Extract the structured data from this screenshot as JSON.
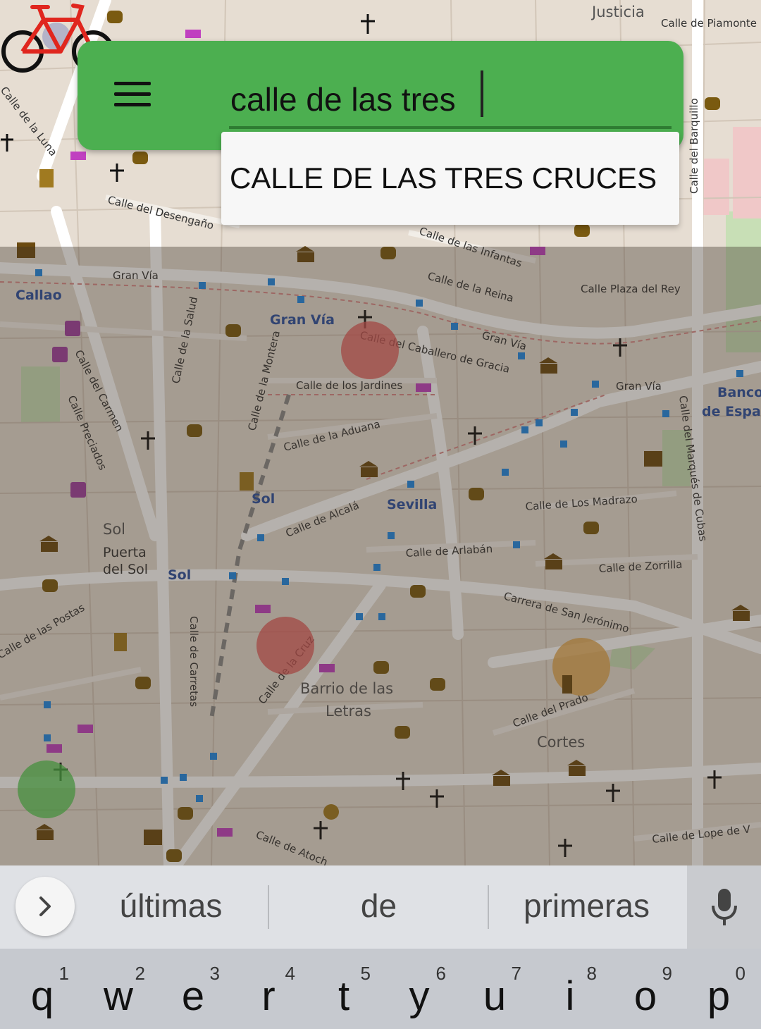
{
  "search": {
    "query": "calle de las tres",
    "suggestion": "CALLE DE LAS TRES CRUCES"
  },
  "map": {
    "labels": {
      "justicia": "Justicia",
      "calle_piamonte": "Calle de Piamonte",
      "calle_barquillo": "Calle del Barquillo",
      "calle_luna": "Calle de la Luna",
      "calle_desengano": "Calle del Desengaño",
      "calle_infantas": "Calle de las Infantas",
      "gran_via_top": "Gran Vía",
      "callao": "Callao",
      "calle_reina": "Calle de la Reina",
      "calle_plaza_rey": "Calle Plaza del Rey",
      "metro_gran_via": "Gran Vía",
      "calle_salud": "Calle de la Salud",
      "calle_caballero": "Calle del Caballero de Gracia",
      "gran_via_mid": "Gran Vía",
      "gran_via_right": "Gran Vía",
      "banco": "Banco",
      "de_espana": "de Espa",
      "calle_jardines": "Calle de los Jardines",
      "calle_montera": "Calle de la Montera",
      "calle_carmen": "Calle del Carmen",
      "calle_preciados": "Calle Preciados",
      "calle_aduana": "Calle de la Aduana",
      "calle_marques_cubas": "Calle del Marqués de Cubas",
      "metro_sol": "Sol",
      "metro_sevilla": "Sevilla",
      "calle_madrazo": "Calle de Los Madrazo",
      "calle_alcala": "Calle de Alcalá",
      "sol_district": "Sol",
      "puerta": "Puerta",
      "del_sol": "del Sol",
      "metro_sol2": "Sol",
      "calle_arlaban": "Calle de Arlabán",
      "calle_zorrilla": "Calle de Zorrilla",
      "carrera_san_jeronimo": "Carrera de San Jerónimo",
      "calle_postas": "Calle de las Postas",
      "calle_carretas": "Calle de Carretas",
      "calle_cruz": "Calle de la Cruz",
      "barrio_letras": "Barrio de las",
      "letras": "Letras",
      "calle_prado": "Calle del Prado",
      "cortes": "Cortes",
      "calle_lope": "Calle de Lope de V",
      "calle_atocha": "Calle de Atoch"
    }
  },
  "keyboard": {
    "suggestions": [
      "últimas",
      "de",
      "primeras"
    ],
    "keys": [
      {
        "letter": "q",
        "num": "1"
      },
      {
        "letter": "w",
        "num": "2"
      },
      {
        "letter": "e",
        "num": "3"
      },
      {
        "letter": "r",
        "num": "4"
      },
      {
        "letter": "t",
        "num": "5"
      },
      {
        "letter": "y",
        "num": "6"
      },
      {
        "letter": "u",
        "num": "7"
      },
      {
        "letter": "i",
        "num": "8"
      },
      {
        "letter": "o",
        "num": "9"
      },
      {
        "letter": "p",
        "num": "0"
      }
    ]
  },
  "colors": {
    "accent": "#4caf50",
    "accent_dark": "#2e7d32",
    "marker_red": "#e05555",
    "marker_orange": "#e0a040",
    "marker_green": "#4cc94c"
  }
}
